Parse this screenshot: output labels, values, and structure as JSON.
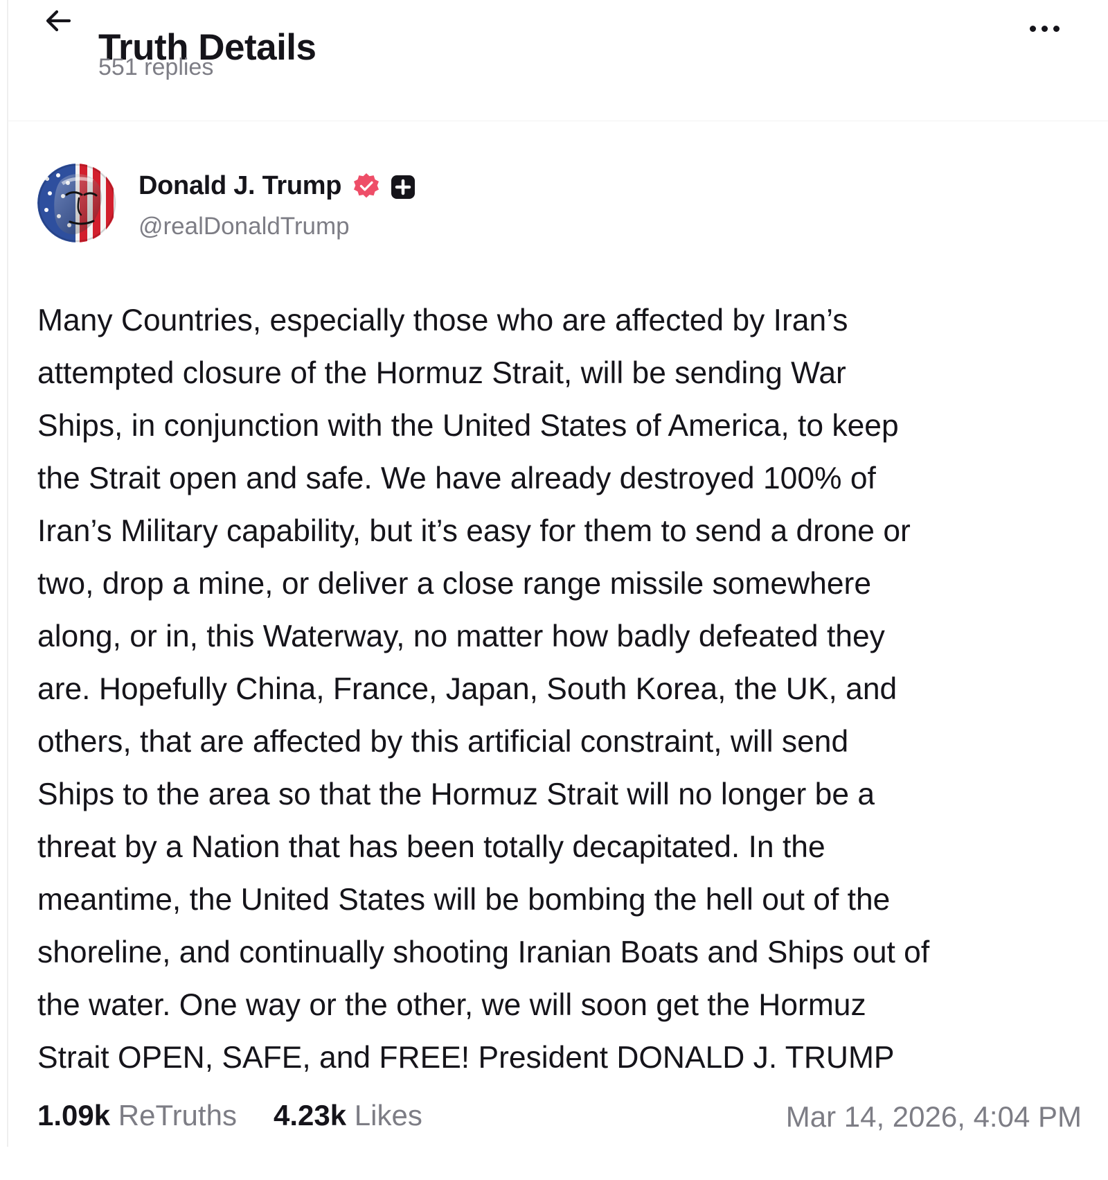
{
  "header": {
    "title": "Truth Details",
    "reply_count": "551 replies",
    "back_icon": "arrow-left-icon",
    "more_icon": "more-horizontal-icon"
  },
  "post": {
    "author": {
      "display_name": "Donald J. Trump",
      "handle": "@realDonaldTrump",
      "verified_badge": "verified-icon",
      "verified_color": "#ee4e68",
      "plus_badge": "plus-square-icon",
      "avatar": "avatar-image"
    },
    "text": "Many Countries, especially those who are affected by Iran’s\nattempted closure of the Hormuz Strait, will be sending War\nShips, in conjunction with the United States of America, to keep\nthe Strait open and safe. We have already destroyed 100% of\nIran’s Military capability, but it’s easy for them to send a drone or\ntwo, drop a mine, or deliver a close range missile somewhere\nalong, or in, this Waterway, no matter how badly defeated they\nare. Hopefully China, France, Japan, South Korea, the UK, and\nothers, that are affected by this artificial constraint, will send\nShips to the area so that the Hormuz Strait will no longer be a\nthreat by a Nation that has been totally decapitated. In the\nmeantime, the United States will be bombing the hell out of the\nshoreline, and continually shooting Iranian Boats and Ships out of\nthe water. One way or the other, we will soon get the Hormuz\nStrait OPEN, SAFE, and FREE! President DONALD J. TRUMP",
    "stats": {
      "retruths_count": "1.09k",
      "retruths_label": "ReTruths",
      "likes_count": "4.23k",
      "likes_label": "Likes"
    },
    "timestamp": "Mar 14, 2026, 4:04 PM"
  },
  "colors": {
    "text_primary": "#15141a",
    "text_secondary": "#7d7d85",
    "verified_badge": "#ee4e68",
    "background": "#ffffff"
  }
}
